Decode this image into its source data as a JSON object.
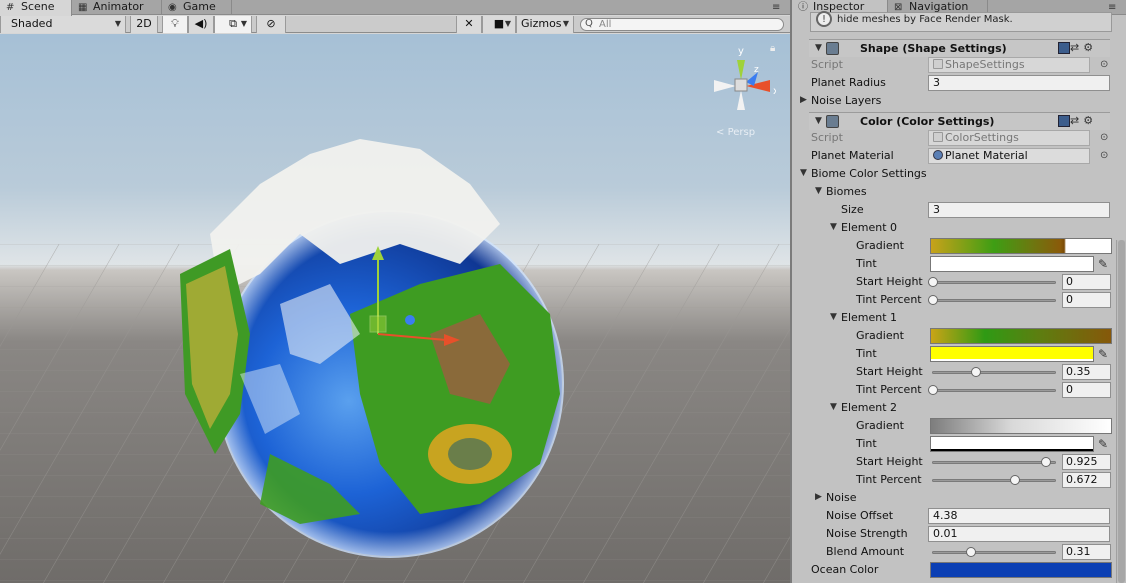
{
  "scene_tabs": [
    {
      "label": "Scene",
      "icon": "grid-icon"
    },
    {
      "label": "Animator",
      "icon": "animator-icon"
    },
    {
      "label": "Game",
      "icon": "game-controller-icon"
    }
  ],
  "toolbar": {
    "draw_mode": "Shaded",
    "mode_2d": "2D",
    "gizmos_label": "Gizmos",
    "search_placeholder": "All",
    "search_prefix": "Q"
  },
  "viewport": {
    "projection_label": "Persp",
    "gizmo_axes": {
      "y": "y",
      "x": "x",
      "z": "z"
    }
  },
  "inspector_tabs": [
    {
      "label": "Inspector",
      "icon": "info-icon"
    },
    {
      "label": "Navigation",
      "icon": "navigation-icon"
    }
  ],
  "inspector": {
    "hint_text": "hide meshes by Face Render Mask.",
    "shape_component": {
      "title": "Shape (Shape Settings)",
      "script_label": "Script",
      "script_value": "ShapeSettings",
      "planet_radius_label": "Planet Radius",
      "planet_radius": "3",
      "noise_layers_label": "Noise Layers"
    },
    "color_component": {
      "title": "Color (Color Settings)",
      "script_label": "Script",
      "script_value": "ColorSettings",
      "planet_material_label": "Planet Material",
      "planet_material": "Planet Material",
      "biome_color_settings_label": "Biome Color Settings",
      "biomes_label": "Biomes",
      "size_label": "Size",
      "size": "3",
      "elements": [
        {
          "name": "Element 0",
          "gradient_label": "Gradient",
          "tint_label": "Tint",
          "tint_color": "#ffffff",
          "start_height_label": "Start Height",
          "start_height": "0",
          "tint_percent_label": "Tint Percent",
          "tint_percent": "0"
        },
        {
          "name": "Element 1",
          "gradient_label": "Gradient",
          "tint_label": "Tint",
          "tint_color": "#ffff00",
          "start_height_label": "Start Height",
          "start_height": "0.35",
          "tint_percent_label": "Tint Percent",
          "tint_percent": "0"
        },
        {
          "name": "Element 2",
          "gradient_label": "Gradient",
          "tint_label": "Tint",
          "tint_color": "#ffffff",
          "start_height_label": "Start Height",
          "start_height": "0.925",
          "tint_percent_label": "Tint Percent",
          "tint_percent": "0.672"
        }
      ],
      "noise_label": "Noise",
      "noise_offset_label": "Noise Offset",
      "noise_offset": "4.38",
      "noise_strength_label": "Noise Strength",
      "noise_strength": "0.01",
      "blend_amount_label": "Blend Amount",
      "blend_amount": "0.31",
      "ocean_color_label": "Ocean Color",
      "ocean_color": "#0b3fb4"
    }
  },
  "colors": {
    "gradient0": "linear-gradient(90deg,#c8a21a 0%,#3e9e14 35%,#6a7a10 55%,#8a5a0a 72%,#7a4a06 74%,#ffffff 75%)",
    "gradient1": "linear-gradient(90deg,#caa416 0%,#2f9a14 30%,#5d7e10 60%,#86580a 100%)",
    "gradient2": "linear-gradient(90deg,#7d7d7d 0%,#d9d9d9 45%,#ffffff 100%)"
  }
}
